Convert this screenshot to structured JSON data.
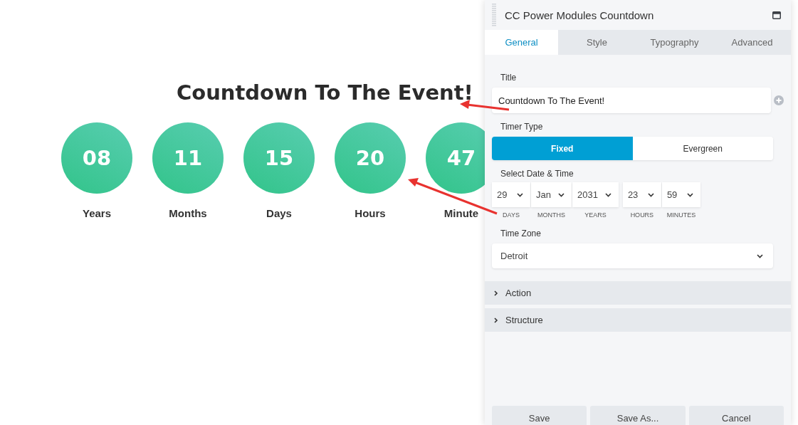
{
  "countdown": {
    "heading": "Countdown To The Event!",
    "units": [
      {
        "value": "08",
        "label": "Years"
      },
      {
        "value": "11",
        "label": "Months"
      },
      {
        "value": "15",
        "label": "Days"
      },
      {
        "value": "20",
        "label": "Hours"
      },
      {
        "value": "47",
        "label": "Minute"
      }
    ]
  },
  "panel": {
    "title": "CC Power Modules Countdown",
    "tabs": [
      {
        "label": "General",
        "selected": true
      },
      {
        "label": "Style",
        "selected": false
      },
      {
        "label": "Typography",
        "selected": false
      },
      {
        "label": "Advanced",
        "selected": false
      }
    ],
    "title_field": {
      "label": "Title",
      "value": "Countdown To The Event!"
    },
    "timer_type": {
      "label": "Timer Type",
      "options": [
        {
          "label": "Fixed",
          "selected": true
        },
        {
          "label": "Evergreen",
          "selected": false
        }
      ]
    },
    "date_time": {
      "label": "Select Date & Time",
      "date_parts": [
        {
          "value": "29",
          "caption": "DAYS"
        },
        {
          "value": "Jan",
          "caption": "MONTHS"
        },
        {
          "value": "2031",
          "caption": "YEARS"
        }
      ],
      "time_parts": [
        {
          "value": "23",
          "caption": "HOURS"
        },
        {
          "value": "59",
          "caption": "MINUTES"
        }
      ]
    },
    "time_zone": {
      "label": "Time Zone",
      "value": "Detroit"
    },
    "sections": [
      {
        "label": "Action",
        "expanded": false
      },
      {
        "label": "Structure",
        "expanded": false
      }
    ],
    "buttons": [
      "Save",
      "Save As...",
      "Cancel"
    ]
  }
}
